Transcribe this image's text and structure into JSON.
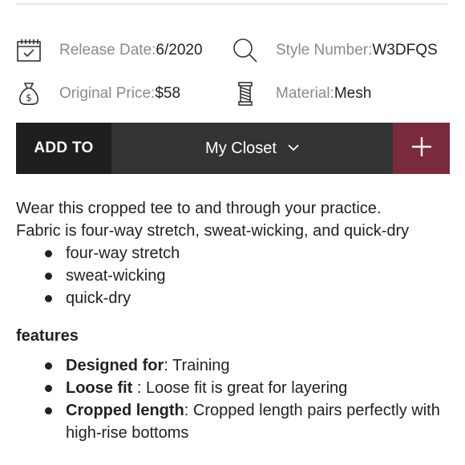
{
  "meta": {
    "release": {
      "label": "Release Date: ",
      "value": "6/2020",
      "icon": "calendar-icon"
    },
    "style": {
      "label": "Style Number: ",
      "value": "W3DFQS",
      "icon": "search-icon"
    },
    "price": {
      "label": "Original Price: ",
      "value": "$58",
      "icon": "money-bag-icon"
    },
    "material": {
      "label": "Material: ",
      "value": "Mesh",
      "icon": "thread-spool-icon"
    }
  },
  "add_bar": {
    "add_to_label": "ADD TO",
    "closet_value": "My Closet",
    "chevron": "⌵",
    "plus": "+",
    "colors": {
      "accent": "#7b2a3c",
      "dark": "#1f1f1f",
      "mid": "#333333"
    }
  },
  "description": {
    "line1": "Wear this cropped tee to and through your practice.",
    "line2": "Fabric is four-way stretch, sweat-wicking, and quick-dry",
    "bullets": [
      "four-way stretch",
      "sweat-wicking",
      "quick-dry"
    ]
  },
  "features": {
    "title": "features",
    "items": [
      {
        "bold": "Designed for",
        "text": ": Training"
      },
      {
        "bold": "Loose fit",
        "text": " : Loose fit is great for layering"
      },
      {
        "bold": "Cropped length",
        "text": ": Cropped length pairs perfectly with high-rise bottoms"
      }
    ]
  }
}
